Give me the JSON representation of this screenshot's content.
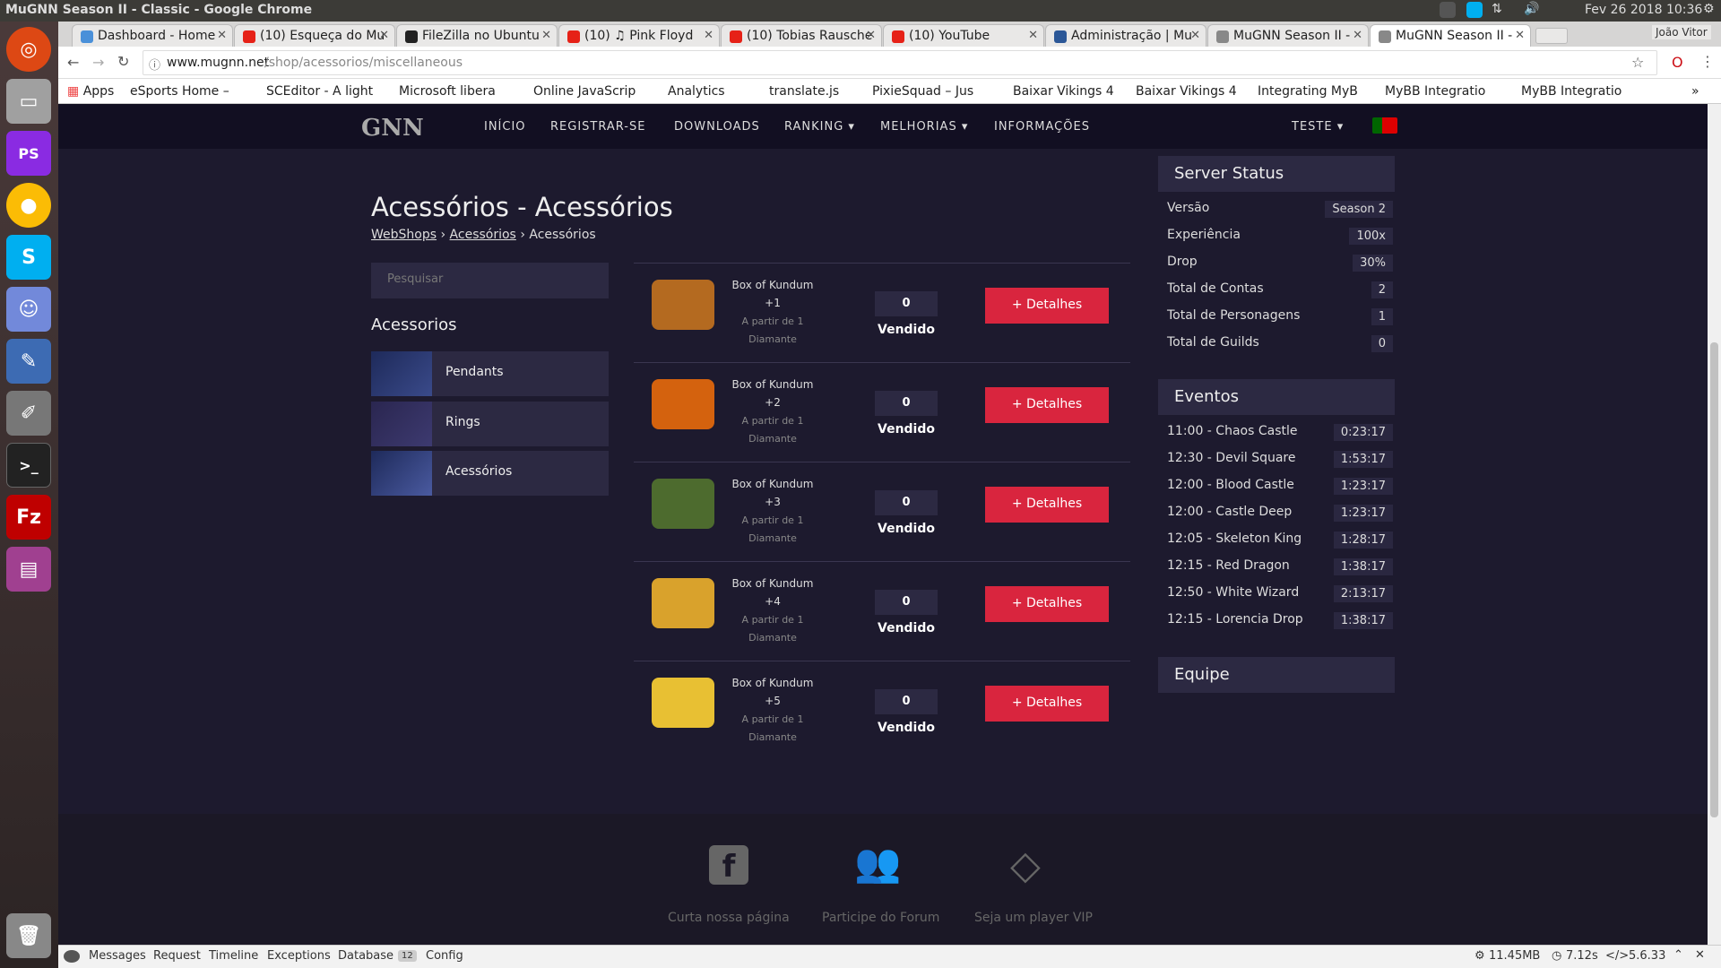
{
  "os": {
    "window_title": "MuGNN Season II - Classic - Google Chrome",
    "datetime": "Fev 26 2018 10:36",
    "user": "João Vitor"
  },
  "tabs": [
    {
      "label": "Dashboard - Home",
      "color": "#4a90d9"
    },
    {
      "label": "(10) Esqueça do Mu",
      "color": "#e62117"
    },
    {
      "label": "FileZilla no Ubuntu",
      "color": "#222222"
    },
    {
      "label": "(10) ♫ Pink Floyd",
      "color": "#e62117"
    },
    {
      "label": "(10) Tobias Rausche",
      "color": "#e62117"
    },
    {
      "label": "(10) YouTube",
      "color": "#e62117"
    },
    {
      "label": "Administração | Mu",
      "color": "#2b5797"
    },
    {
      "label": "MuGNN Season II -",
      "color": "#888888"
    },
    {
      "label": "MuGNN Season II -",
      "color": "#888888"
    }
  ],
  "url": {
    "host": "www.mugnn.net",
    "path": "/shop/acessorios/miscellaneous"
  },
  "bookmarks": [
    "Apps",
    "eSports Home –",
    "SCEditor - A light",
    "Microsoft libera",
    "Online JavaScrip",
    "Analytics",
    "translate.js",
    "PixieSquad – Jus",
    "Baixar Vikings 4",
    "Baixar Vikings 4",
    "Integrating MyB",
    "MyBB Integratio",
    "MyBB Integratio"
  ],
  "site": {
    "logo": "GNN",
    "nav": [
      "INÍCIO",
      "REGISTRAR-SE",
      "DOWNLOADS",
      "RANKING ▾",
      "MELHORIAS ▾",
      "INFORMAÇÕES"
    ],
    "user_menu": "TESTE ▾"
  },
  "page": {
    "title": "Acessórios - Acessórios",
    "breadcrumb": [
      "WebShops",
      "Acessórios",
      "Acessórios"
    ],
    "search_placeholder": "Pesquisar",
    "category_heading": "Acessorios",
    "categories": [
      "Pendants",
      "Rings",
      "Acessórios"
    ]
  },
  "products": [
    {
      "name": "Box of Kundum",
      "level": "+1",
      "price_line1": "A partir de 1",
      "price_line2": "Diamante",
      "count": "0",
      "sold_label": "Vendido",
      "button": "+ Detalhes",
      "color": "#b46a20"
    },
    {
      "name": "Box of Kundum",
      "level": "+2",
      "price_line1": "A partir de 1",
      "price_line2": "Diamante",
      "count": "0",
      "sold_label": "Vendido",
      "button": "+ Detalhes",
      "color": "#d4620e"
    },
    {
      "name": "Box of Kundum",
      "level": "+3",
      "price_line1": "A partir de 1",
      "price_line2": "Diamante",
      "count": "0",
      "sold_label": "Vendido",
      "button": "+ Detalhes",
      "color": "#4d6b2e"
    },
    {
      "name": "Box of Kundum",
      "level": "+4",
      "price_line1": "A partir de 1",
      "price_line2": "Diamante",
      "count": "0",
      "sold_label": "Vendido",
      "button": "+ Detalhes",
      "color": "#d9a22c"
    },
    {
      "name": "Box of Kundum",
      "level": "+5",
      "price_line1": "A partir de 1",
      "price_line2": "Diamante",
      "count": "0",
      "sold_label": "Vendido",
      "button": "+ Detalhes",
      "color": "#e8c033"
    }
  ],
  "server_status": {
    "title": "Server Status",
    "rows": [
      {
        "label": "Versão",
        "value": "Season 2"
      },
      {
        "label": "Experiência",
        "value": "100x"
      },
      {
        "label": "Drop",
        "value": "30%"
      },
      {
        "label": "Total de Contas",
        "value": "2"
      },
      {
        "label": "Total de Personagens",
        "value": "1"
      },
      {
        "label": "Total de Guilds",
        "value": "0"
      }
    ]
  },
  "events": {
    "title": "Eventos",
    "rows": [
      {
        "label": "11:00 - Chaos Castle",
        "value": "0:23:17"
      },
      {
        "label": "12:30 - Devil Square",
        "value": "1:53:17"
      },
      {
        "label": "12:00 - Blood Castle",
        "value": "1:23:17"
      },
      {
        "label": "12:00 - Castle Deep",
        "value": "1:23:17"
      },
      {
        "label": "12:05 - Skeleton King",
        "value": "1:28:17"
      },
      {
        "label": "12:15 - Red Dragon",
        "value": "1:38:17"
      },
      {
        "label": "12:50 - White Wizard",
        "value": "2:13:17"
      },
      {
        "label": "12:15 - Lorencia Drop",
        "value": "1:38:17"
      }
    ]
  },
  "team": {
    "title": "Equipe"
  },
  "footer": [
    "Curta nossa página",
    "Participe do Forum",
    "Seja um player VIP"
  ],
  "debugbar": {
    "tabs": [
      "Messages",
      "Request",
      "Timeline",
      "Exceptions",
      "Database",
      "Config"
    ],
    "db_count": "12",
    "memory": "11.45MB",
    "time": "7.12s",
    "php": "5.6.33"
  }
}
